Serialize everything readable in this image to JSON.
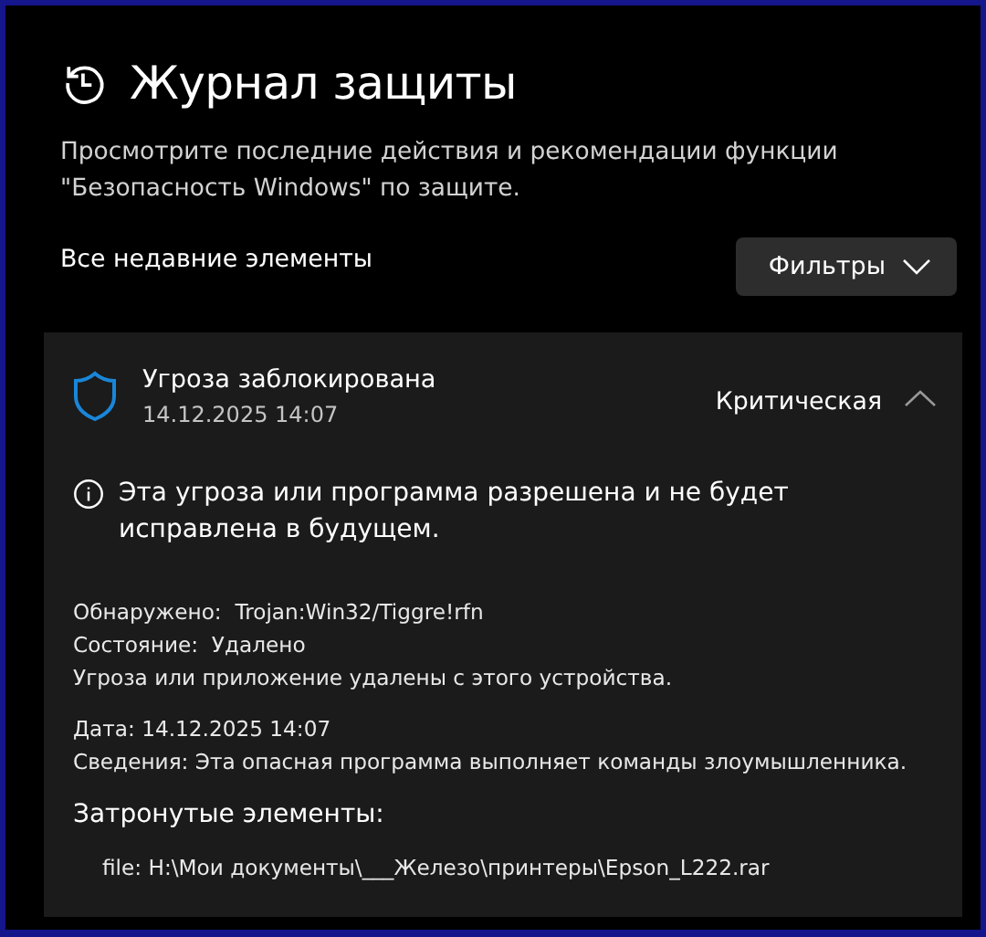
{
  "page": {
    "title": "Журнал защиты",
    "description": "Просмотрите последние действия и рекомендации функции \"Безопасность Windows\" по защите.",
    "section_label": "Все недавние элементы",
    "filter_button": "Фильтры"
  },
  "events": [
    {
      "title": "Угроза заблокирована",
      "date": "14.12.2025 14:07",
      "severity": "Критическая",
      "expanded": true,
      "notice": "Эта угроза или программа разрешена и не будет исправлена в будущем.",
      "details_1": [
        {
          "label": "Обнаружено:",
          "value": "Trojan:Win32/Tiggre!rfn"
        },
        {
          "label": "Состояние:",
          "value": "Удалено"
        }
      ],
      "status_note": "Угроза или приложение удалены с этого устройства.",
      "details_2": [
        {
          "label": "Дата:",
          "value": "14.12.2025 14:07"
        },
        {
          "label": "Сведения:",
          "value": "Эта опасная программа выполняет команды злоумышленника."
        }
      ],
      "affected_heading": "Затронутые элементы:",
      "affected_items": [
        "file: H:\\Мои документы\\___Железо\\принтеры\\Epson_L222.rar"
      ]
    }
  ]
}
